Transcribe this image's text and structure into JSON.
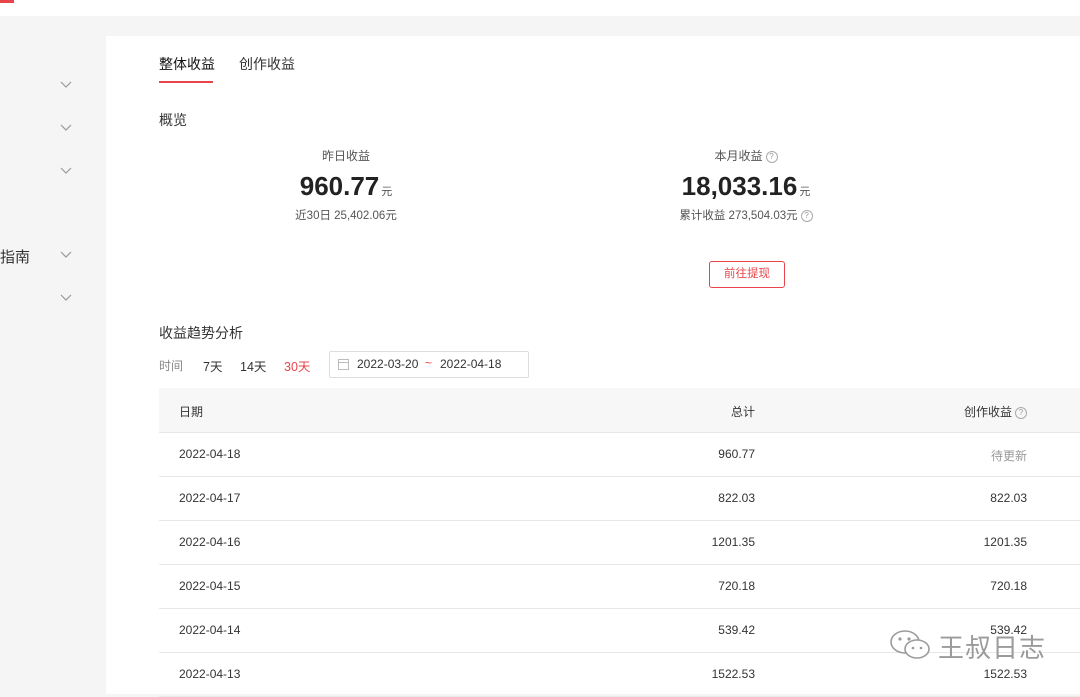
{
  "sidebar": {
    "items": [
      {
        "label": "",
        "has_chevron": false
      },
      {
        "label": "",
        "has_chevron": true
      },
      {
        "label": "",
        "has_chevron": true
      },
      {
        "label": "",
        "has_chevron": true
      },
      {
        "label": "",
        "has_chevron": false
      },
      {
        "label": "指南",
        "has_chevron": true
      },
      {
        "label": "",
        "has_chevron": true
      },
      {
        "label": "",
        "has_chevron": false
      }
    ]
  },
  "tabs": [
    {
      "label": "整体收益",
      "active": true
    },
    {
      "label": "创作收益",
      "active": false
    }
  ],
  "overview": {
    "title": "概览",
    "yesterday": {
      "label": "昨日收益",
      "value": "960.77",
      "unit": "元",
      "sub": "近30日 25,402.06元"
    },
    "month": {
      "label": "本月收益",
      "value": "18,033.16",
      "unit": "元",
      "sub": "累计收益 273,504.03元"
    },
    "withdraw_button": "前往提现"
  },
  "trend": {
    "title": "收益趋势分析",
    "time_label": "时间",
    "options": [
      {
        "label": "7天",
        "active": false
      },
      {
        "label": "14天",
        "active": false
      },
      {
        "label": "30天",
        "active": true
      }
    ],
    "date_start": "2022-03-20",
    "date_sep": "~",
    "date_end": "2022-04-18"
  },
  "table": {
    "headers": {
      "date": "日期",
      "total": "总计",
      "creation": "创作收益"
    },
    "rows": [
      {
        "date": "2022-04-18",
        "total": "960.77",
        "creation": "待更新"
      },
      {
        "date": "2022-04-17",
        "total": "822.03",
        "creation": "822.03"
      },
      {
        "date": "2022-04-16",
        "total": "1201.35",
        "creation": "1201.35"
      },
      {
        "date": "2022-04-15",
        "total": "720.18",
        "creation": "720.18"
      },
      {
        "date": "2022-04-14",
        "total": "539.42",
        "creation": "539.42"
      },
      {
        "date": "2022-04-13",
        "total": "1522.53",
        "creation": "1522.53"
      }
    ]
  },
  "watermark": {
    "text": "王叔日志",
    "icon": "wechat-icon"
  },
  "colors": {
    "accent": "#e8454a",
    "muted": "#999999"
  }
}
